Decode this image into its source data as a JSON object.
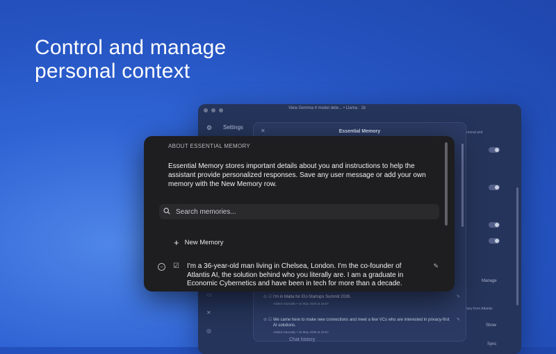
{
  "headline": {
    "line1": "Control and manage",
    "line2": "personal context"
  },
  "bg_window": {
    "title": "View Gemma 4 model dete... • Llama · 1b",
    "sidebar_title": "Settings",
    "right_text_top": "Personal and",
    "manage_label": "Manage",
    "history_text": "history from Atlantis",
    "show_label": "Show",
    "sync_label": "Sync"
  },
  "modal": {
    "title": "Essential Memory",
    "items": [
      {
        "text": "I'm in Malta for EU-Startups Summit 2026.",
        "meta": "Added manually • 15 May 2026 at 18:57"
      },
      {
        "text": "We came here to make new connections and meet a few VCs who are interested in privacy-first AI solutions.",
        "meta": "Added manually • 15 May 2026 at 18:57"
      }
    ],
    "chat_history": "Chat history"
  },
  "popup": {
    "about_title": "ABOUT ESSENTIAL MEMORY",
    "about_text": "Essential Memory stores important details about you and instructions to help the assistant provide personalized responses. Save any user message or add your own memory with the New Memory row.",
    "search_placeholder": "Search memories...",
    "new_memory_label": "New Memory",
    "memory_text": "I'm a 36-year-old man living in Chelsea, London. I'm the co-founder of Atlantis AI, the solution behind who you literally are. I am a graduate in Economic Cybernetics and have been in tech for more than a decade."
  },
  "icons": {
    "search": "search-icon",
    "plus": "plus-icon",
    "remove": "minus-circle-icon",
    "edit": "edit-square-icon",
    "pencil": "pencil-icon",
    "close": "close-icon",
    "gear": "gear-icon"
  }
}
